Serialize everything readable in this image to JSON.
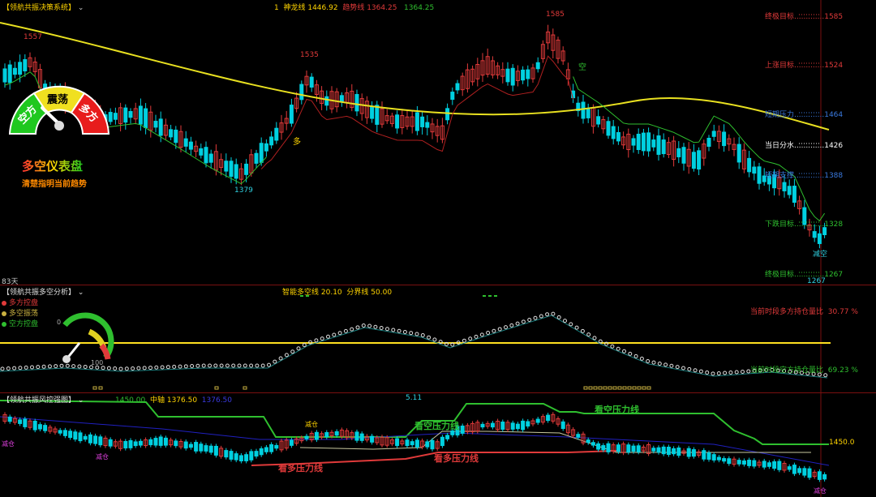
{
  "panel1": {
    "title": "【领航共振决策系统】",
    "indicator_num": "1",
    "shenlong_label": "神龙线",
    "shenlong_value": "1446.92",
    "trend_label": "趋势线",
    "trend_value": "1364.25",
    "extra_value": "1364.25",
    "days_label": "83天",
    "levels": [
      {
        "label": "终极目标",
        "value": "1585",
        "color": "#e03a3a"
      },
      {
        "label": "上涨目标",
        "value": "1524",
        "color": "#e03a3a"
      },
      {
        "label": "短期压力",
        "value": "1464",
        "color": "#3a7ae0"
      },
      {
        "label": "当日分水",
        "value": "1426",
        "color": "#ffffff"
      },
      {
        "label": "短期支撑",
        "value": "1388",
        "color": "#3a7ae0"
      },
      {
        "label": "下跌目标",
        "value": "1328",
        "color": "#2fbf2f"
      },
      {
        "label": "终极目标",
        "value": "1267",
        "color": "#2fbf2f"
      }
    ],
    "peak_labels": [
      "1557",
      "1535",
      "1585",
      "1379",
      "1267"
    ],
    "signal_duo": "多",
    "signal_kong": "空",
    "signal_jiankong": "减空",
    "gauge_kong": "空方",
    "gauge_zhendang": "震荡",
    "gauge_duo": "多方",
    "gauge_title": "多空仪表盘",
    "gauge_subtitle": "清楚指明当前趋势"
  },
  "panel2": {
    "title": "【领航共振多空分析】",
    "smart_label": "智能多空线",
    "smart_value": "20.10",
    "boundary_label": "分界线",
    "boundary_value": "50.00",
    "legend": [
      {
        "label": "多方控盘",
        "color": "#e03a3a"
      },
      {
        "label": "多空振荡",
        "color": "#c8b040"
      },
      {
        "label": "空方控盘",
        "color": "#2fbf2f"
      }
    ],
    "gauge_0": "0",
    "gauge_100": "100",
    "duo_ratio_label": "当前时段多方持仓量比",
    "duo_ratio_value": "30.77 %",
    "kong_ratio_label": "当前时段空方持仓量比",
    "kong_ratio_value": "69.23 %"
  },
  "panel3": {
    "title": "【领航共振风控强图】",
    "upper_value": "1450.00",
    "mid_label": "中轴",
    "mid_value": "1376.50",
    "lower_value": "1376.50",
    "extra_value": "5.11",
    "right_value": "1450.0",
    "kong_pressure_1": "看空压力线",
    "kong_pressure_2": "看空压力线",
    "duo_pressure_1": "看多压力线",
    "duo_pressure_2": "看多压力线",
    "jiancang_1": "减仓",
    "jiancang_2": "减仓",
    "jiancang_3": "减仓",
    "jiancang_4": "减仓"
  }
}
